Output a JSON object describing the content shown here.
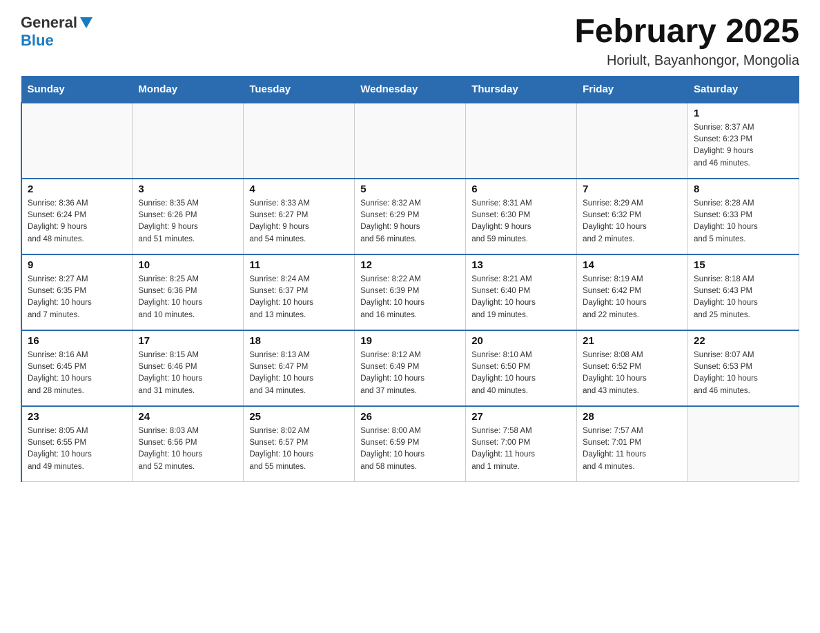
{
  "header": {
    "logo": {
      "general": "General",
      "blue": "Blue"
    },
    "title": "February 2025",
    "location": "Horiult, Bayanhongor, Mongolia"
  },
  "days_of_week": [
    "Sunday",
    "Monday",
    "Tuesday",
    "Wednesday",
    "Thursday",
    "Friday",
    "Saturday"
  ],
  "weeks": [
    [
      {
        "day": "",
        "info": ""
      },
      {
        "day": "",
        "info": ""
      },
      {
        "day": "",
        "info": ""
      },
      {
        "day": "",
        "info": ""
      },
      {
        "day": "",
        "info": ""
      },
      {
        "day": "",
        "info": ""
      },
      {
        "day": "1",
        "info": "Sunrise: 8:37 AM\nSunset: 6:23 PM\nDaylight: 9 hours\nand 46 minutes."
      }
    ],
    [
      {
        "day": "2",
        "info": "Sunrise: 8:36 AM\nSunset: 6:24 PM\nDaylight: 9 hours\nand 48 minutes."
      },
      {
        "day": "3",
        "info": "Sunrise: 8:35 AM\nSunset: 6:26 PM\nDaylight: 9 hours\nand 51 minutes."
      },
      {
        "day": "4",
        "info": "Sunrise: 8:33 AM\nSunset: 6:27 PM\nDaylight: 9 hours\nand 54 minutes."
      },
      {
        "day": "5",
        "info": "Sunrise: 8:32 AM\nSunset: 6:29 PM\nDaylight: 9 hours\nand 56 minutes."
      },
      {
        "day": "6",
        "info": "Sunrise: 8:31 AM\nSunset: 6:30 PM\nDaylight: 9 hours\nand 59 minutes."
      },
      {
        "day": "7",
        "info": "Sunrise: 8:29 AM\nSunset: 6:32 PM\nDaylight: 10 hours\nand 2 minutes."
      },
      {
        "day": "8",
        "info": "Sunrise: 8:28 AM\nSunset: 6:33 PM\nDaylight: 10 hours\nand 5 minutes."
      }
    ],
    [
      {
        "day": "9",
        "info": "Sunrise: 8:27 AM\nSunset: 6:35 PM\nDaylight: 10 hours\nand 7 minutes."
      },
      {
        "day": "10",
        "info": "Sunrise: 8:25 AM\nSunset: 6:36 PM\nDaylight: 10 hours\nand 10 minutes."
      },
      {
        "day": "11",
        "info": "Sunrise: 8:24 AM\nSunset: 6:37 PM\nDaylight: 10 hours\nand 13 minutes."
      },
      {
        "day": "12",
        "info": "Sunrise: 8:22 AM\nSunset: 6:39 PM\nDaylight: 10 hours\nand 16 minutes."
      },
      {
        "day": "13",
        "info": "Sunrise: 8:21 AM\nSunset: 6:40 PM\nDaylight: 10 hours\nand 19 minutes."
      },
      {
        "day": "14",
        "info": "Sunrise: 8:19 AM\nSunset: 6:42 PM\nDaylight: 10 hours\nand 22 minutes."
      },
      {
        "day": "15",
        "info": "Sunrise: 8:18 AM\nSunset: 6:43 PM\nDaylight: 10 hours\nand 25 minutes."
      }
    ],
    [
      {
        "day": "16",
        "info": "Sunrise: 8:16 AM\nSunset: 6:45 PM\nDaylight: 10 hours\nand 28 minutes."
      },
      {
        "day": "17",
        "info": "Sunrise: 8:15 AM\nSunset: 6:46 PM\nDaylight: 10 hours\nand 31 minutes."
      },
      {
        "day": "18",
        "info": "Sunrise: 8:13 AM\nSunset: 6:47 PM\nDaylight: 10 hours\nand 34 minutes."
      },
      {
        "day": "19",
        "info": "Sunrise: 8:12 AM\nSunset: 6:49 PM\nDaylight: 10 hours\nand 37 minutes."
      },
      {
        "day": "20",
        "info": "Sunrise: 8:10 AM\nSunset: 6:50 PM\nDaylight: 10 hours\nand 40 minutes."
      },
      {
        "day": "21",
        "info": "Sunrise: 8:08 AM\nSunset: 6:52 PM\nDaylight: 10 hours\nand 43 minutes."
      },
      {
        "day": "22",
        "info": "Sunrise: 8:07 AM\nSunset: 6:53 PM\nDaylight: 10 hours\nand 46 minutes."
      }
    ],
    [
      {
        "day": "23",
        "info": "Sunrise: 8:05 AM\nSunset: 6:55 PM\nDaylight: 10 hours\nand 49 minutes."
      },
      {
        "day": "24",
        "info": "Sunrise: 8:03 AM\nSunset: 6:56 PM\nDaylight: 10 hours\nand 52 minutes."
      },
      {
        "day": "25",
        "info": "Sunrise: 8:02 AM\nSunset: 6:57 PM\nDaylight: 10 hours\nand 55 minutes."
      },
      {
        "day": "26",
        "info": "Sunrise: 8:00 AM\nSunset: 6:59 PM\nDaylight: 10 hours\nand 58 minutes."
      },
      {
        "day": "27",
        "info": "Sunrise: 7:58 AM\nSunset: 7:00 PM\nDaylight: 11 hours\nand 1 minute."
      },
      {
        "day": "28",
        "info": "Sunrise: 7:57 AM\nSunset: 7:01 PM\nDaylight: 11 hours\nand 4 minutes."
      },
      {
        "day": "",
        "info": ""
      }
    ]
  ]
}
